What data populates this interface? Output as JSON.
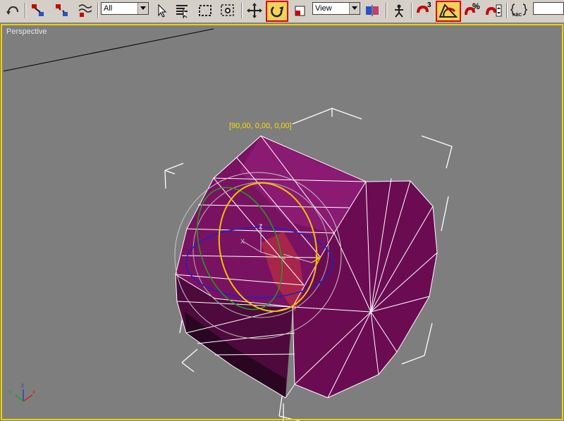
{
  "toolbar": {
    "buttons": [
      {
        "icon": "undo-arc-icon"
      },
      {
        "icon": "select-and-link-icon"
      },
      {
        "icon": "unlink-selection-icon"
      },
      {
        "icon": "bind-to-space-warp-icon"
      },
      {
        "icon": "select-object-icon"
      },
      {
        "icon": "select-by-name-icon"
      },
      {
        "icon": "rectangular-selection-region-icon"
      },
      {
        "icon": "window-crossing-selection-icon"
      },
      {
        "icon": "select-and-move-icon"
      },
      {
        "icon": "select-and-rotate-icon",
        "active": true
      },
      {
        "icon": "select-and-scale-icon"
      },
      {
        "icon": "use-pivot-center-icon"
      },
      {
        "icon": "select-and-manipulate-icon"
      },
      {
        "icon": "snaps-toggle-icon"
      },
      {
        "icon": "angle-snap-toggle-icon",
        "active": true
      },
      {
        "icon": "percent-snap-toggle-icon"
      },
      {
        "icon": "spinner-snap-toggle-icon"
      },
      {
        "icon": "edit-named-selection-sets-icon"
      }
    ],
    "selection_filter": "All",
    "reference_coord": "View",
    "snap_badge": "3",
    "percent_badge": "%",
    "named_sel_badge": "ABC"
  },
  "viewport": {
    "label": "Perspective",
    "rotation_readout": "[90,00, 0,00, 0,00]",
    "gizmo_axes": {
      "x": "X",
      "y": "Y",
      "z": "Z"
    },
    "corner_axes": {
      "x": "x",
      "y": "y",
      "z": "z"
    }
  },
  "colors": {
    "viewport_bg": "#7e7e7e",
    "active_border": "#f0d000",
    "object": "#6e0f55",
    "wire": "#ffffff",
    "highlight": "#e00000"
  }
}
